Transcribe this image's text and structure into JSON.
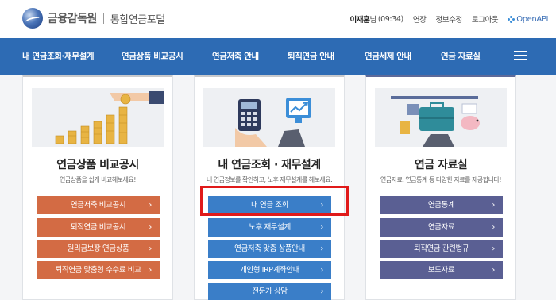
{
  "header": {
    "brand_name": "금융감독원",
    "portal_name": "통합연금포털",
    "user_name": "이재훈",
    "user_suffix": "님",
    "session_time": "(09:34)",
    "links": [
      "연장",
      "정보수정",
      "로그아웃"
    ],
    "openapi_label": "OpenAPI"
  },
  "nav": {
    "items": [
      "내 연금조회·재무설계",
      "연금상품 비교공시",
      "연금저축 안내",
      "퇴직연금 안내",
      "연금세제 안내",
      "연금 자료실"
    ],
    "menu_icon": "hamburger-menu-icon"
  },
  "cards": [
    {
      "title": "연금상품 비교공시",
      "subtitle": "연금상품을 쉽게 비교해보세요!",
      "buttons": [
        "연금저축 비교공시",
        "퇴직연금 비교공시",
        "원리금보장 연금상품",
        "퇴직연금 맞춤형 수수료 비교"
      ]
    },
    {
      "title": "내 연금조회 · 재무설계",
      "subtitle": "내 연금정보를 확인하고, 노후 재무설계를 해보세요.",
      "buttons": [
        "내 연금 조회",
        "노후 재무설계",
        "연금저축 맞춤 상품안내",
        "개인형 IRP계좌안내",
        "전문가 상담"
      ]
    },
    {
      "title": "연금 자료실",
      "subtitle": "연금자료, 연금통계 등 다양한 자료를 제공합니다!",
      "buttons": [
        "연금통계",
        "연금자료",
        "퇴직연금 관련법규",
        "보도자료"
      ]
    }
  ],
  "colors": {
    "nav_bg": "#2d6bb4",
    "card1_button": "#d36b44",
    "card2_button": "#3a7ec8",
    "card3_button": "#5a5f93",
    "highlight_border": "#e01a1a"
  },
  "chevron": "›"
}
